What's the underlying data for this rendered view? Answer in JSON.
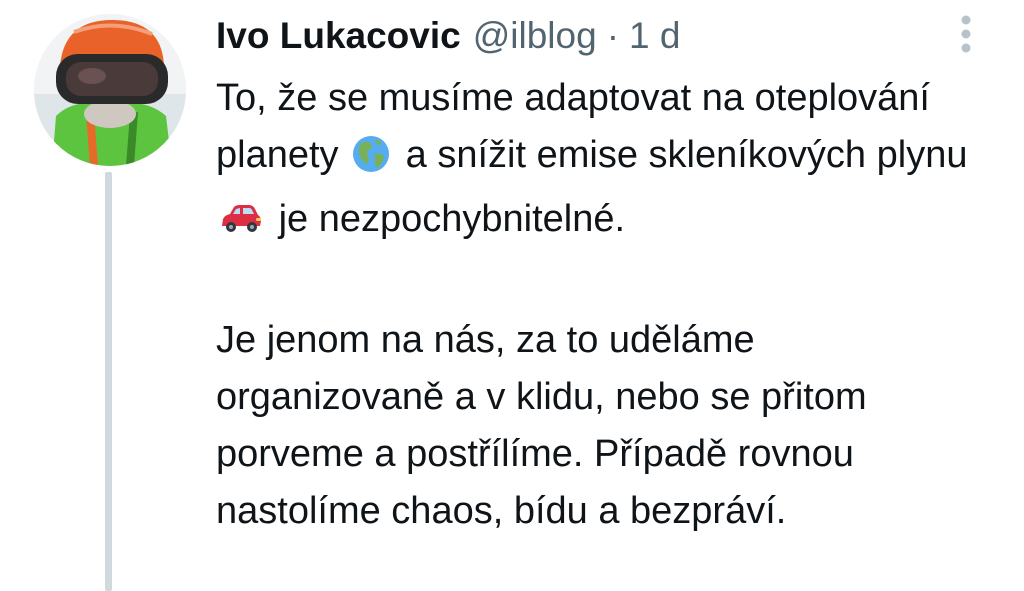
{
  "tweet": {
    "display_name": "Ivo Lukacovic",
    "handle": "@ilblog",
    "separator": "·",
    "time": "1 d",
    "paragraph_1": {
      "part_1": "To, že se musíme adaptovat na oteplování planety",
      "emoji_1": "globe-americas-icon",
      "part_2": "a snížit emise skleníkových plynu",
      "emoji_2": "red-car-icon",
      "part_3": "je nezpochybnitelné."
    },
    "paragraph_2": "Je jenom na nás, za to uděláme organizovaně a v klidu, nebo se přitom porveme a postřílíme. Případě rovnou nastolíme chaos, bídu a bezpráví."
  },
  "icons": {
    "more": "vertical-ellipsis-icon"
  },
  "colors": {
    "text": "#0f1419",
    "secondary": "#536471",
    "thread_line": "#cfd9de"
  }
}
